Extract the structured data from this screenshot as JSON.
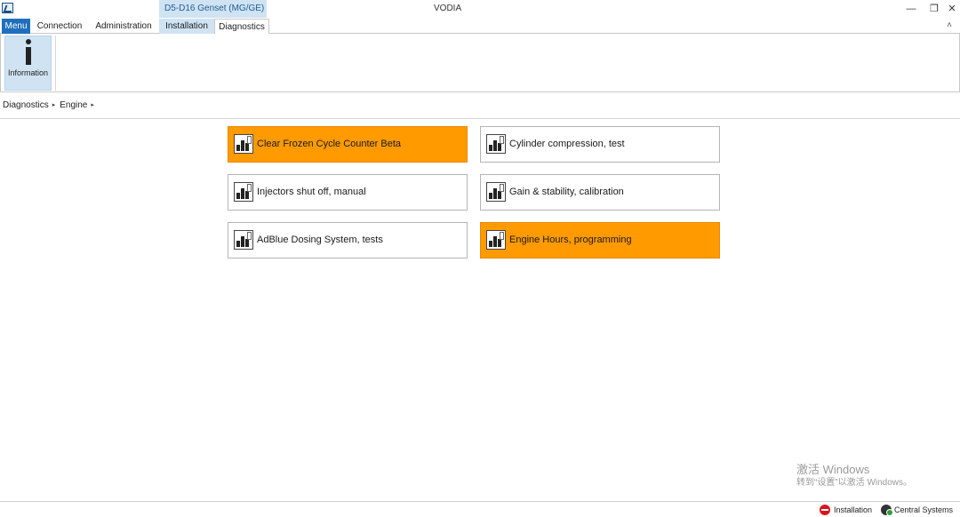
{
  "titlebar": {
    "context_tab_header": "D5-D16 Genset (MG/GE)",
    "app_title": "VODIA",
    "minimize_glyph": "—",
    "restore_glyph": "❐",
    "close_glyph": "✕"
  },
  "tabs": {
    "menu": "Menu",
    "items": [
      "Connection",
      "Administration",
      "Installation",
      "Diagnostics"
    ],
    "active": "Diagnostics",
    "collapse_glyph": "˄"
  },
  "ribbon": {
    "buttons": [
      {
        "label": "Information",
        "icon": "info-icon"
      }
    ]
  },
  "breadcrumb": {
    "items": [
      "Diagnostics",
      "Engine"
    ],
    "separator": "▸"
  },
  "tiles": [
    {
      "label": "Clear Frozen Cycle Counter Beta",
      "highlighted": true,
      "icon": "diagnostic-tool-icon"
    },
    {
      "label": "Cylinder compression, test",
      "highlighted": false,
      "icon": "diagnostic-tool-icon"
    },
    {
      "label": "Injectors shut off, manual",
      "highlighted": false,
      "icon": "diagnostic-tool-icon"
    },
    {
      "label": "Gain & stability, calibration",
      "highlighted": false,
      "icon": "diagnostic-tool-icon"
    },
    {
      "label": "AdBlue Dosing System, tests",
      "highlighted": false,
      "icon": "diagnostic-tool-icon"
    },
    {
      "label": "Engine Hours, programming",
      "highlighted": true,
      "icon": "diagnostic-tool-icon"
    }
  ],
  "statusbar": {
    "installation": "Installation",
    "central_systems": "Central Systems"
  },
  "activation_notice": {
    "line1": "激活 Windows",
    "line2": "转到“设置”以激活 Windows。"
  },
  "colors": {
    "accent_blue": "#1f6fbd",
    "context_tab": "#cfe3f3",
    "tile_highlight": "#ff9a00",
    "status_stop": "#d8141e"
  }
}
